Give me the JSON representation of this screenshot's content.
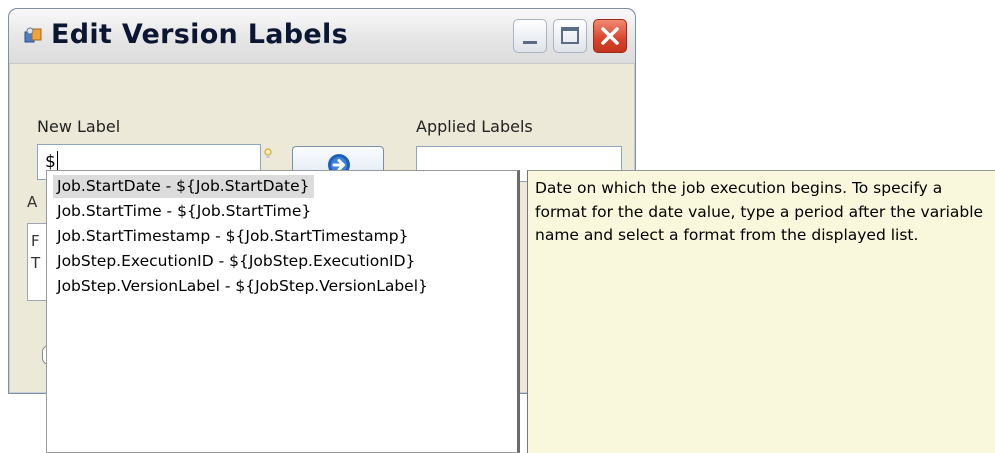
{
  "window": {
    "title": "Edit Version Labels"
  },
  "form": {
    "new_label_caption": "New Label",
    "new_label_value": "$",
    "applied_labels_caption": "Applied Labels",
    "fragment_a": "A",
    "fragment_f": "F",
    "fragment_t": "T"
  },
  "completion": {
    "items": [
      {
        "label": "Job.StartDate - ${Job.StartDate}",
        "selected": true
      },
      {
        "label": "Job.StartTime - ${Job.StartTime}",
        "selected": false
      },
      {
        "label": "Job.StartTimestamp - ${Job.StartTimestamp}",
        "selected": false
      },
      {
        "label": "JobStep.ExecutionID - ${JobStep.ExecutionID}",
        "selected": false
      },
      {
        "label": "JobStep.VersionLabel - ${JobStep.VersionLabel}",
        "selected": false
      }
    ],
    "description": "Date on which the job execution begins. To specify a format for the date value, type a period after the variable name and select a format from the displayed list."
  },
  "icons": {
    "app": "app-icon",
    "minimize": "minimize-icon",
    "maximize": "maximize-icon",
    "close": "close-icon",
    "apply": "arrow-right-icon",
    "hint": "lightbulb-icon"
  },
  "colors": {
    "tooltip_background": "#f9f8dc",
    "selected_item": "#dcdcdc",
    "close_button": "#d8432a"
  }
}
